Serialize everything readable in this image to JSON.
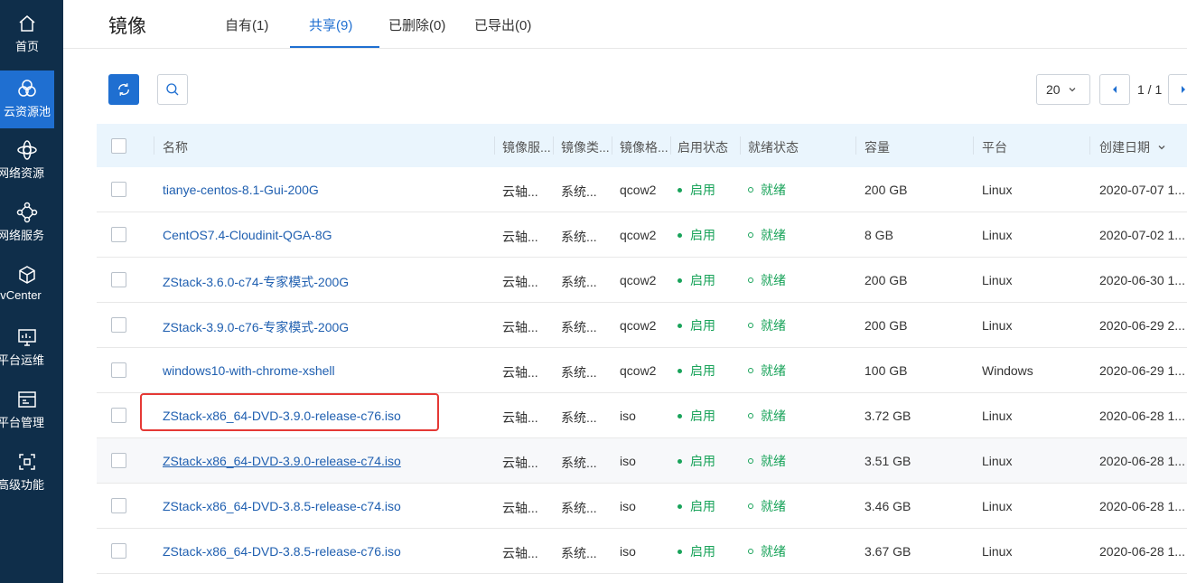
{
  "sidebar": {
    "items": [
      {
        "label": "首页",
        "icon": "home-icon"
      },
      {
        "label": "云资源池",
        "icon": "cloud-pool-icon",
        "active": true
      },
      {
        "label": "网络资源",
        "icon": "network-resource-icon"
      },
      {
        "label": "网络服务",
        "icon": "network-service-icon"
      },
      {
        "label": "vCenter",
        "icon": "cube-icon"
      },
      {
        "label": "平台运维",
        "icon": "monitor-icon"
      },
      {
        "label": "平台管理",
        "icon": "management-icon"
      },
      {
        "label": "高级功能",
        "icon": "advanced-icon"
      }
    ]
  },
  "header": {
    "title": "镜像",
    "tabs": [
      {
        "label": "自有(1)"
      },
      {
        "label": "共享(9)",
        "active": true
      },
      {
        "label": "已删除(0)"
      },
      {
        "label": "已导出(0)"
      }
    ]
  },
  "toolbar": {
    "refresh_icon": "refresh-icon",
    "search_icon": "search-icon"
  },
  "pagination": {
    "page_size": "20",
    "page_info": "1 / 1"
  },
  "table": {
    "columns": [
      "名称",
      "镜像服...",
      "镜像类...",
      "镜像格...",
      "启用状态",
      "就绪状态",
      "容量",
      "平台",
      "创建日期"
    ],
    "sort_icon": "chevron-down-icon",
    "rows": [
      {
        "name": "tianye-centos-8.1-Gui-200G",
        "server": "云轴...",
        "type": "系统...",
        "format": "qcow2",
        "enable": "启用",
        "ready": "就绪",
        "size": "200 GB",
        "platform": "Linux",
        "date": "2020-07-07 1..."
      },
      {
        "name": "CentOS7.4-Cloudinit-QGA-8G",
        "server": "云轴...",
        "type": "系统...",
        "format": "qcow2",
        "enable": "启用",
        "ready": "就绪",
        "size": "8 GB",
        "platform": "Linux",
        "date": "2020-07-02 1..."
      },
      {
        "name": "ZStack-3.6.0-c74-专家模式-200G",
        "server": "云轴...",
        "type": "系统...",
        "format": "qcow2",
        "enable": "启用",
        "ready": "就绪",
        "size": "200 GB",
        "platform": "Linux",
        "date": "2020-06-30 1..."
      },
      {
        "name": "ZStack-3.9.0-c76-专家模式-200G",
        "server": "云轴...",
        "type": "系统...",
        "format": "qcow2",
        "enable": "启用",
        "ready": "就绪",
        "size": "200 GB",
        "platform": "Linux",
        "date": "2020-06-29 2..."
      },
      {
        "name": "windows10-with-chrome-xshell",
        "server": "云轴...",
        "type": "系统...",
        "format": "qcow2",
        "enable": "启用",
        "ready": "就绪",
        "size": "100 GB",
        "platform": "Windows",
        "date": "2020-06-29 1..."
      },
      {
        "name": "ZStack-x86_64-DVD-3.9.0-release-c76.iso",
        "server": "云轴...",
        "type": "系统...",
        "format": "iso",
        "enable": "启用",
        "ready": "就绪",
        "size": "3.72 GB",
        "platform": "Linux",
        "date": "2020-06-28 1..."
      },
      {
        "name": "ZStack-x86_64-DVD-3.9.0-release-c74.iso",
        "server": "云轴...",
        "type": "系统...",
        "format": "iso",
        "enable": "启用",
        "ready": "就绪",
        "size": "3.51 GB",
        "platform": "Linux",
        "date": "2020-06-28 1..."
      },
      {
        "name": "ZStack-x86_64-DVD-3.8.5-release-c74.iso",
        "server": "云轴...",
        "type": "系统...",
        "format": "iso",
        "enable": "启用",
        "ready": "就绪",
        "size": "3.46 GB",
        "platform": "Linux",
        "date": "2020-06-28 1..."
      },
      {
        "name": "ZStack-x86_64-DVD-3.8.5-release-c76.iso",
        "server": "云轴...",
        "type": "系统...",
        "format": "iso",
        "enable": "启用",
        "ready": "就绪",
        "size": "3.67 GB",
        "platform": "Linux",
        "date": "2020-06-28 1..."
      }
    ]
  },
  "colors": {
    "sidebar_bg": "#0f2e4a",
    "accent": "#1f6fd1",
    "status_green": "#19a35a",
    "highlight_red": "#e53935"
  }
}
